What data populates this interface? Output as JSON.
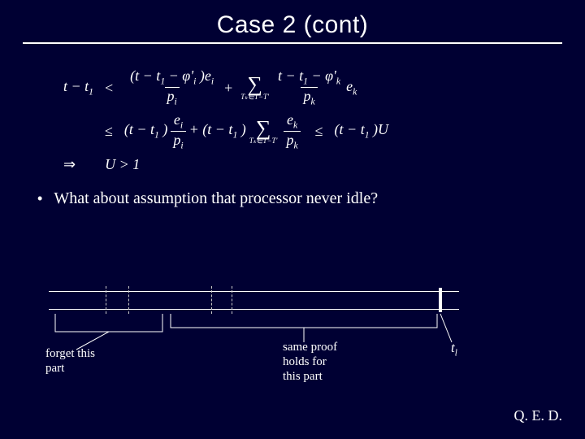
{
  "title": "Case 2 (cont)",
  "math": {
    "lhs": "t − t",
    "lhs_sub": "1",
    "lt": "<",
    "line1_num_a": "(t − t",
    "line1_num_a_sub": "1",
    "line1_num_b": " − φ'",
    "line1_num_b_sub": "i",
    "line1_num_c": " )e",
    "line1_num_c_sub": "i",
    "line1_den_a": "p",
    "line1_den_a_sub": "i",
    "plus": "+",
    "sigma": "∑",
    "sigma_sub": "Tₖ∈T−T'",
    "line1_num2_a": "t − t",
    "line1_num2_a_sub": "1",
    "line1_num2_b": " − φ'",
    "line1_num2_b_sub": "k",
    "line1_den2_a": "p",
    "line1_den2_a_sub": "k",
    "line1_tail": "e",
    "line1_tail_sub": "k",
    "le": "≤",
    "line2_a": "(t − t",
    "line2_a_sub": "1",
    "line2_b": " )",
    "line2_frac1_num": "e",
    "line2_frac1_num_sub": "i",
    "line2_frac1_den": "p",
    "line2_frac1_den_sub": "i",
    "line2_c": " + (t − t",
    "line2_c_sub": "1",
    "line2_d": " )",
    "line2_frac2_num": "e",
    "line2_frac2_num_sub": "k",
    "line2_frac2_den": "p",
    "line2_frac2_den_sub": "k",
    "line2_rhs_a": "(t − t",
    "line2_rhs_a_sub": "1",
    "line2_rhs_b": " )U",
    "implies": "⇒",
    "line3": "U > 1"
  },
  "bullet": "What about assumption that processor never idle?",
  "labels": {
    "forget": "forget this\npart",
    "sameproof": "same proof\nholds for\nthis part",
    "tl": "t",
    "tl_sub": "l"
  },
  "qed": "Q. E. D."
}
